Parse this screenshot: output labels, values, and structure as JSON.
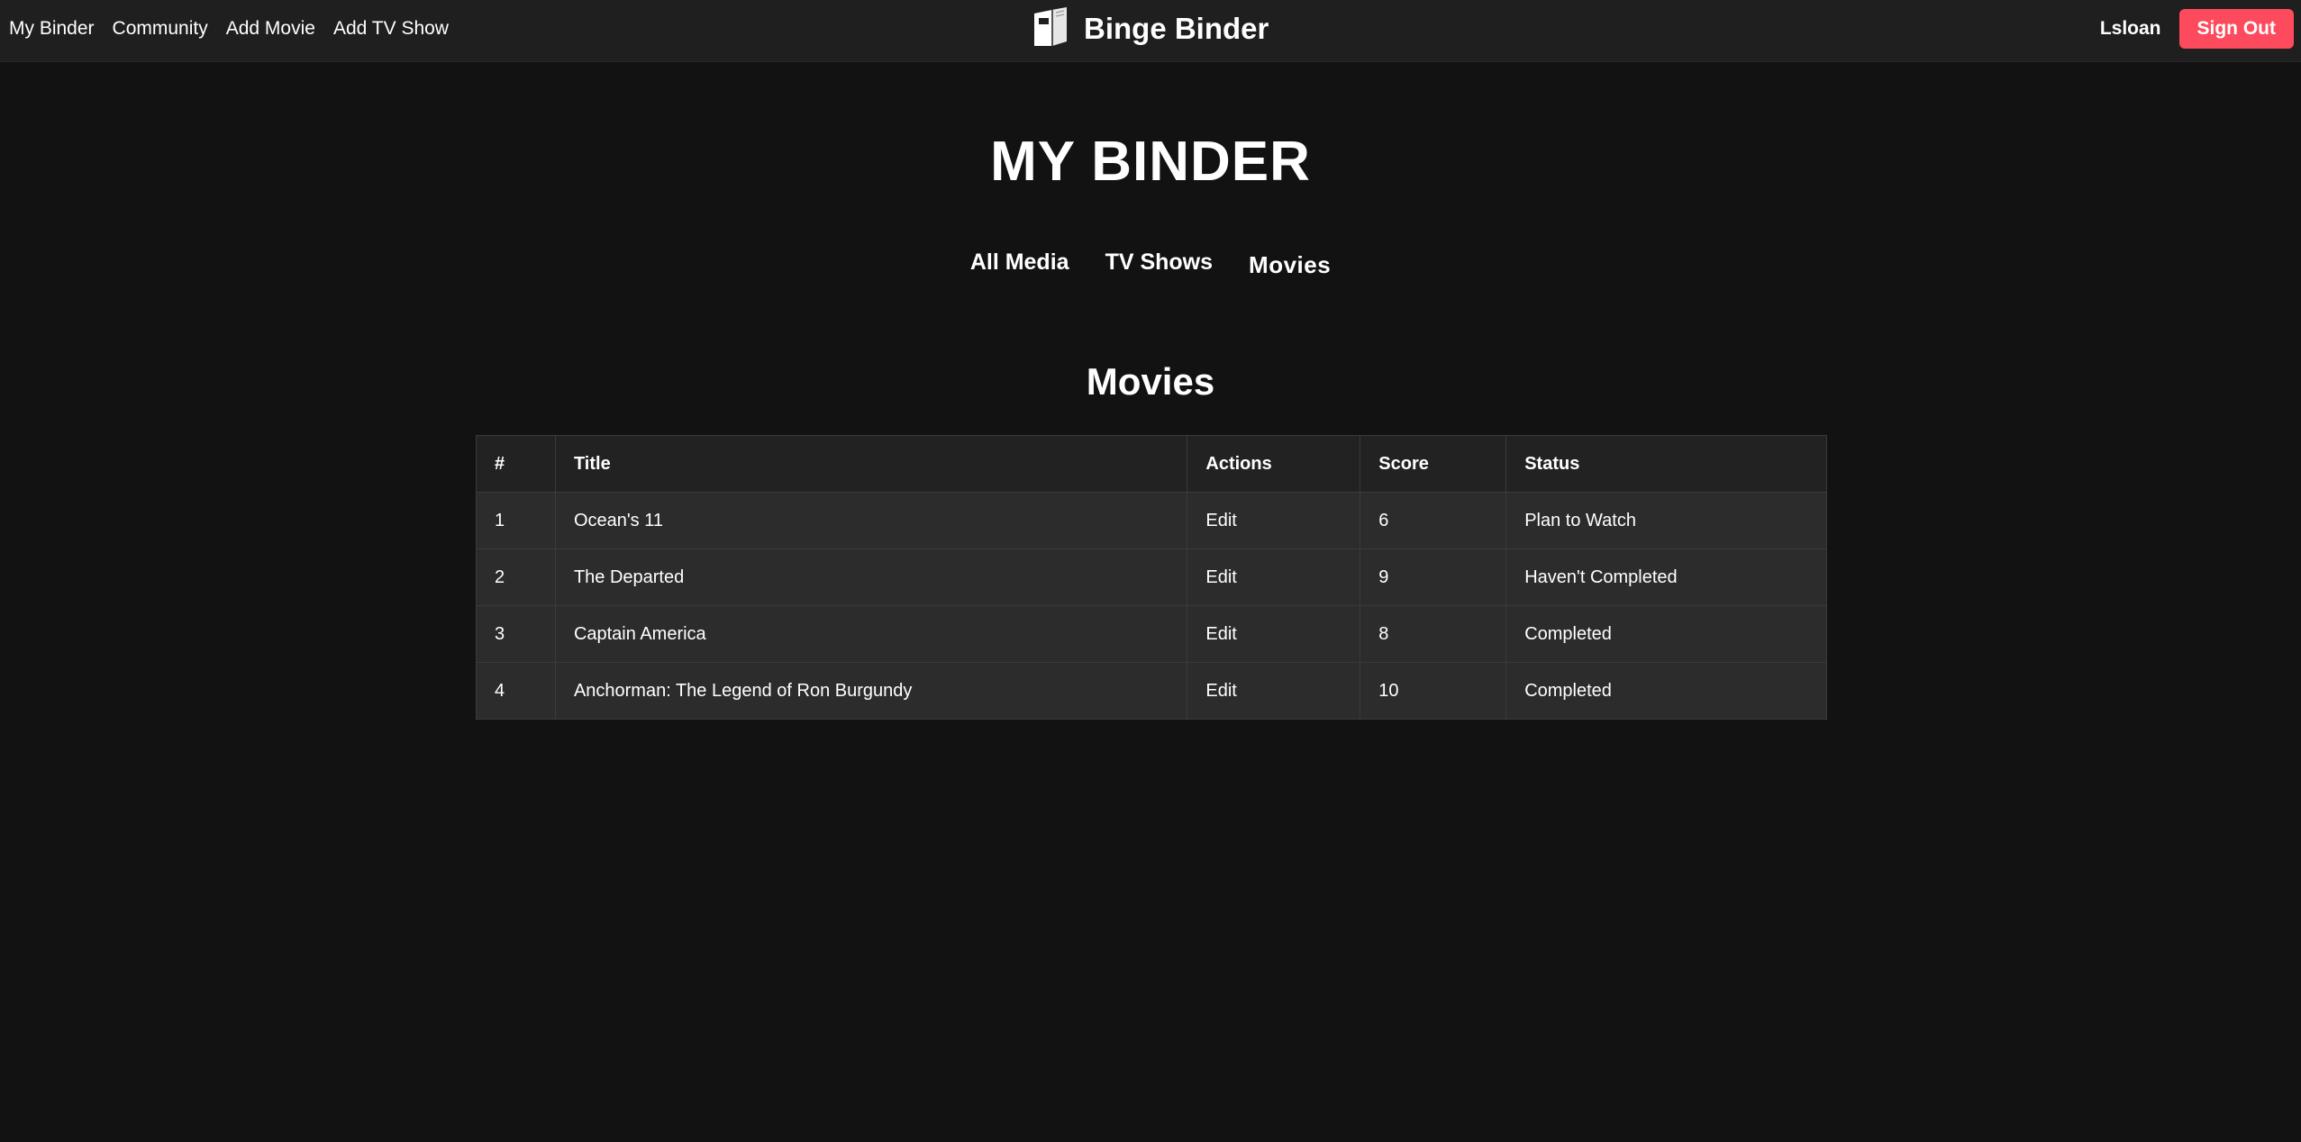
{
  "nav": {
    "links": [
      "My Binder",
      "Community",
      "Add Movie",
      "Add TV Show"
    ],
    "brand": "Binge Binder",
    "username": "Lsloan",
    "signout": "Sign Out"
  },
  "page": {
    "title": "MY BINDER",
    "tabs": [
      "All Media",
      "TV Shows",
      "Movies"
    ],
    "active_tab": "Movies",
    "section_title": "Movies"
  },
  "table": {
    "headers": [
      "#",
      "Title",
      "Actions",
      "Score",
      "Status"
    ],
    "rows": [
      {
        "num": "1",
        "title": "Ocean's 11",
        "action": "Edit",
        "score": "6",
        "status": "Plan to Watch"
      },
      {
        "num": "2",
        "title": "The Departed",
        "action": "Edit",
        "score": "9",
        "status": "Haven't Completed"
      },
      {
        "num": "3",
        "title": "Captain America",
        "action": "Edit",
        "score": "8",
        "status": "Completed"
      },
      {
        "num": "4",
        "title": "Anchorman: The Legend of Ron Burgundy",
        "action": "Edit",
        "score": "10",
        "status": "Completed"
      }
    ]
  },
  "colors": {
    "background": "#121212",
    "navbar": "#1f1f1f",
    "signout": "#fd4a5c",
    "row": "#2c2c2c",
    "header_row": "#222222"
  },
  "icons": {
    "brand": "binder-icon"
  }
}
